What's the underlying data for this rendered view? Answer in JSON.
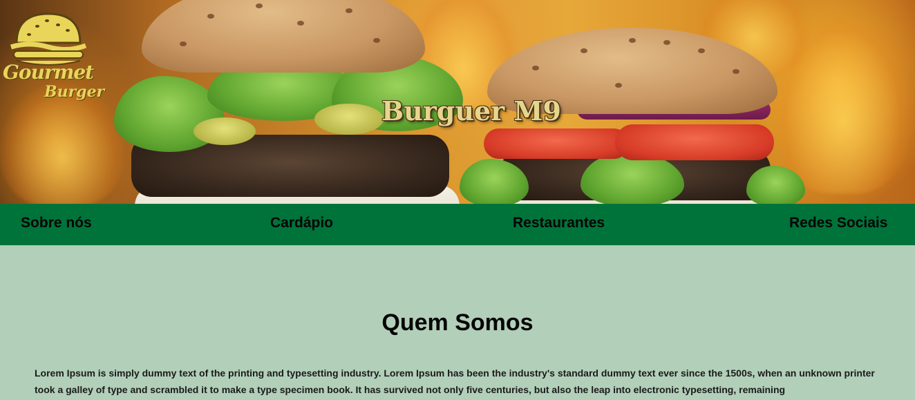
{
  "hero": {
    "logo": {
      "line1": "Gourmet",
      "line2": "Burger"
    },
    "title": "Burguer M9"
  },
  "nav": {
    "items": [
      {
        "label": "Sobre nós"
      },
      {
        "label": "Cardápio"
      },
      {
        "label": "Restaurantes"
      },
      {
        "label": "Redes Sociais"
      }
    ]
  },
  "about": {
    "heading": "Quem Somos",
    "body": "Lorem Ipsum is simply dummy text of the printing and typesetting industry. Lorem Ipsum has been the industry's standard dummy text ever since the 1500s, when an unknown printer took a galley of type and scrambled it to make a type specimen book. It has survived not only five centuries, but also the leap into electronic typesetting, remaining"
  },
  "colors": {
    "nav_background": "#00733a",
    "page_background": "#b2cfb9",
    "logo_yellow": "#e8d55a",
    "title_cream": "#e6d58c"
  }
}
